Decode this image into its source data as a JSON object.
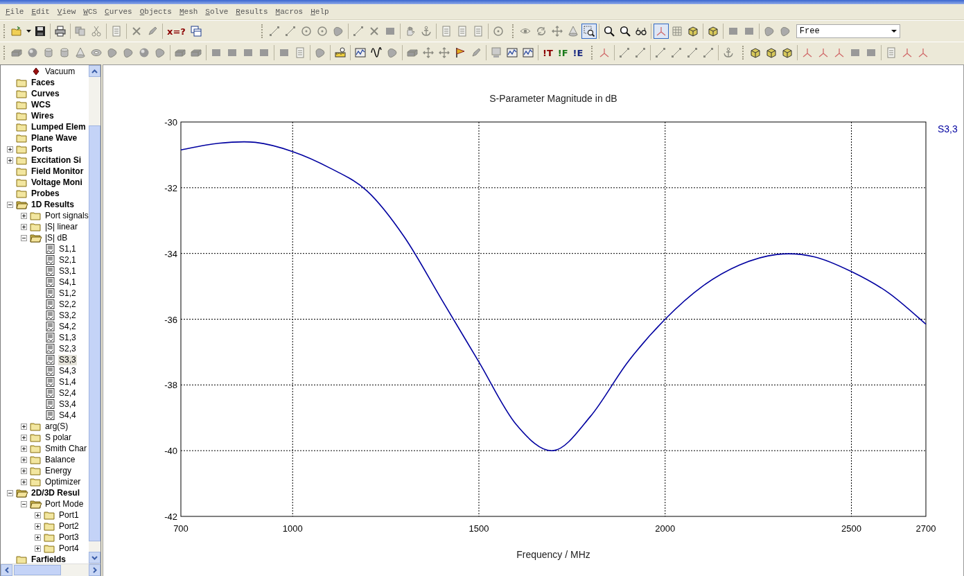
{
  "menu": [
    "File",
    "Edit",
    "View",
    "WCS",
    "Curves",
    "Objects",
    "Mesh",
    "Solve",
    "Results",
    "Macros",
    "Help"
  ],
  "toolbars": [
    {
      "bands": [
        {
          "groups": [
            [
              {
                "kind": "open",
                "pressed": false
              },
              {
                "kind": "caret",
                "pressed": false
              },
              {
                "kind": "save",
                "pressed": false
              }
            ],
            [
              {
                "kind": "print",
                "pressed": false
              }
            ],
            [
              {
                "kind": "copy",
                "pressed": false
              },
              {
                "kind": "cut",
                "pressed": false
              }
            ],
            [
              {
                "kind": "page",
                "pressed": false
              }
            ],
            [
              {
                "kind": "cross",
                "pressed": false
              },
              {
                "kind": "pick",
                "pressed": false
              }
            ],
            [
              {
                "kind": "text",
                "text": "x=?",
                "color": "#8b0000",
                "pressed": false
              },
              {
                "kind": "window",
                "pressed": false
              }
            ]
          ]
        },
        {
          "groups": [
            [
              {
                "kind": "line",
                "pressed": false
              },
              {
                "kind": "line",
                "pressed": false
              },
              {
                "kind": "circle",
                "pressed": false
              },
              {
                "kind": "circle",
                "pressed": false
              },
              {
                "kind": "shape",
                "pressed": false
              }
            ],
            [
              {
                "kind": "line",
                "pressed": false
              },
              {
                "kind": "cross",
                "pressed": false
              },
              {
                "kind": "square",
                "pressed": false
              }
            ],
            [
              {
                "kind": "hand",
                "pressed": false
              },
              {
                "kind": "anchor",
                "pressed": false
              }
            ],
            [
              {
                "kind": "page",
                "pressed": false
              },
              {
                "kind": "page",
                "pressed": false
              },
              {
                "kind": "page",
                "pressed": false
              }
            ],
            [
              {
                "kind": "circle",
                "pressed": false
              }
            ]
          ]
        },
        {
          "groups": [
            [
              {
                "kind": "eye",
                "pressed": false
              },
              {
                "kind": "rotate",
                "pressed": false
              },
              {
                "kind": "move",
                "pressed": false
              },
              {
                "kind": "cone",
                "pressed": false
              },
              {
                "kind": "zoom",
                "pressed": true
              }
            ],
            [
              {
                "kind": "search",
                "pressed": false
              },
              {
                "kind": "search",
                "pressed": false
              },
              {
                "kind": "glasses",
                "pressed": false
              }
            ],
            [
              {
                "kind": "axes",
                "pressed": true
              },
              {
                "kind": "grid",
                "pressed": false
              },
              {
                "kind": "cube",
                "pressed": false
              }
            ],
            [
              {
                "kind": "cube",
                "pressed": false
              }
            ],
            [
              {
                "kind": "square",
                "pressed": false
              },
              {
                "kind": "square",
                "pressed": false
              }
            ],
            [
              {
                "kind": "shape",
                "pressed": false
              },
              {
                "kind": "shape",
                "pressed": false
              }
            ]
          ],
          "combo": {
            "value": "Free"
          }
        }
      ]
    },
    {
      "bands": [
        {
          "groups": [
            [
              {
                "kind": "brick",
                "pressed": false
              },
              {
                "kind": "sphere",
                "pressed": false
              },
              {
                "kind": "cylinder",
                "pressed": false
              },
              {
                "kind": "cylinder",
                "pressed": false
              },
              {
                "kind": "cone",
                "pressed": false
              },
              {
                "kind": "ring",
                "pressed": false
              },
              {
                "kind": "shape",
                "pressed": false
              },
              {
                "kind": "shape",
                "pressed": false
              },
              {
                "kind": "sphere",
                "pressed": false
              },
              {
                "kind": "shape",
                "pressed": false
              }
            ],
            [
              {
                "kind": "brick",
                "pressed": false
              },
              {
                "kind": "brick",
                "pressed": false
              }
            ],
            [
              {
                "kind": "square",
                "pressed": false
              },
              {
                "kind": "square",
                "pressed": false
              },
              {
                "kind": "square",
                "pressed": false
              },
              {
                "kind": "square",
                "pressed": false
              }
            ],
            [
              {
                "kind": "square",
                "pressed": false
              },
              {
                "kind": "page",
                "pressed": false
              }
            ],
            [
              {
                "kind": "shape",
                "pressed": false
              }
            ],
            [
              {
                "kind": "ruler",
                "pressed": false
              }
            ],
            [
              {
                "kind": "chart",
                "pressed": false
              },
              {
                "kind": "sine",
                "pressed": false
              },
              {
                "kind": "shape",
                "pressed": false
              }
            ],
            [
              {
                "kind": "brick",
                "pressed": false
              },
              {
                "kind": "move",
                "pressed": false
              },
              {
                "kind": "move",
                "pressed": false
              },
              {
                "kind": "flag",
                "pressed": false
              },
              {
                "kind": "pick",
                "pressed": false
              }
            ],
            [
              {
                "kind": "monitor",
                "pressed": false
              },
              {
                "kind": "chart",
                "pressed": false
              },
              {
                "kind": "chart",
                "pressed": false
              }
            ],
            [
              {
                "kind": "text",
                "text": "!T",
                "color": "#8b0000",
                "pressed": false
              },
              {
                "kind": "text",
                "text": "!F",
                "color": "#1a7a1a",
                "pressed": false
              },
              {
                "kind": "text",
                "text": "!E",
                "color": "#1a2a80",
                "pressed": false
              }
            ]
          ]
        },
        {
          "groups": [
            [
              {
                "kind": "axes",
                "pressed": false
              }
            ],
            [
              {
                "kind": "line",
                "pressed": false
              },
              {
                "kind": "line",
                "pressed": false
              }
            ],
            [
              {
                "kind": "line",
                "pressed": false
              },
              {
                "kind": "line",
                "pressed": false
              },
              {
                "kind": "line",
                "pressed": false
              },
              {
                "kind": "line",
                "pressed": false
              }
            ],
            [
              {
                "kind": "anchor",
                "pressed": false
              }
            ]
          ]
        },
        {
          "groups": [
            [
              {
                "kind": "cube",
                "pressed": false
              },
              {
                "kind": "cube",
                "pressed": false
              },
              {
                "kind": "cube",
                "pressed": false
              }
            ],
            [
              {
                "kind": "axes",
                "pressed": false
              },
              {
                "kind": "axes",
                "pressed": false
              },
              {
                "kind": "axes",
                "pressed": false
              },
              {
                "kind": "square",
                "pressed": false
              },
              {
                "kind": "square",
                "pressed": false
              }
            ],
            [
              {
                "kind": "page",
                "pressed": false
              },
              {
                "kind": "axes",
                "pressed": false
              },
              {
                "kind": "axes",
                "pressed": false
              }
            ]
          ]
        }
      ]
    }
  ],
  "tree": {
    "items": [
      {
        "children": [
          {
            "label": "Vacuum",
            "kind": "material",
            "selected": false
          }
        ]
      },
      {
        "label": "Faces",
        "kind": "folder",
        "selected": false
      },
      {
        "label": "Curves",
        "kind": "folder",
        "selected": false
      },
      {
        "label": "WCS",
        "kind": "folder",
        "selected": false
      },
      {
        "label": "Wires",
        "kind": "folder",
        "selected": false
      },
      {
        "label": "Lumped Elem",
        "kind": "folder",
        "selected": false
      },
      {
        "label": "Plane Wave",
        "kind": "folder",
        "selected": false
      },
      {
        "label": "Ports",
        "kind": "folder",
        "selected": false,
        "expanded": false
      },
      {
        "label": "Excitation Si",
        "kind": "folder",
        "selected": false,
        "expanded": false
      },
      {
        "label": "Field Monitor",
        "kind": "folder",
        "selected": false
      },
      {
        "label": "Voltage Moni",
        "kind": "folder",
        "selected": false
      },
      {
        "label": "Probes",
        "kind": "folder",
        "selected": false
      },
      {
        "label": "1D Results",
        "kind": "folder",
        "selected": false,
        "expanded": true,
        "children": [
          {
            "label": "Port signals",
            "kind": "folder",
            "selected": false,
            "expanded": false
          },
          {
            "label": "|S| linear",
            "kind": "folder",
            "selected": false,
            "expanded": false
          },
          {
            "label": "|S| dB",
            "kind": "folder",
            "selected": false,
            "expanded": true,
            "children": [
              {
                "label": "S1,1",
                "kind": "curve",
                "selected": false
              },
              {
                "label": "S2,1",
                "kind": "curve",
                "selected": false
              },
              {
                "label": "S3,1",
                "kind": "curve",
                "selected": false
              },
              {
                "label": "S4,1",
                "kind": "curve",
                "selected": false
              },
              {
                "label": "S1,2",
                "kind": "curve",
                "selected": false
              },
              {
                "label": "S2,2",
                "kind": "curve",
                "selected": false
              },
              {
                "label": "S3,2",
                "kind": "curve",
                "selected": false
              },
              {
                "label": "S4,2",
                "kind": "curve",
                "selected": false
              },
              {
                "label": "S1,3",
                "kind": "curve",
                "selected": false
              },
              {
                "label": "S2,3",
                "kind": "curve",
                "selected": false
              },
              {
                "label": "S3,3",
                "kind": "curve",
                "selected": true
              },
              {
                "label": "S4,3",
                "kind": "curve",
                "selected": false
              },
              {
                "label": "S1,4",
                "kind": "curve",
                "selected": false
              },
              {
                "label": "S2,4",
                "kind": "curve",
                "selected": false
              },
              {
                "label": "S3,4",
                "kind": "curve",
                "selected": false
              },
              {
                "label": "S4,4",
                "kind": "curve",
                "selected": false
              }
            ]
          },
          {
            "label": "arg(S)",
            "kind": "folder",
            "selected": false,
            "expanded": false
          },
          {
            "label": "S polar",
            "kind": "folder",
            "selected": false,
            "expanded": false
          },
          {
            "label": "Smith Char",
            "kind": "folder",
            "selected": false,
            "expanded": false
          },
          {
            "label": "Balance",
            "kind": "folder",
            "selected": false,
            "expanded": false
          },
          {
            "label": "Energy",
            "kind": "folder",
            "selected": false,
            "expanded": false
          },
          {
            "label": "Optimizer",
            "kind": "folder",
            "selected": false,
            "expanded": false
          }
        ]
      },
      {
        "label": "2D/3D Resul",
        "kind": "folder",
        "selected": false,
        "expanded": true,
        "children": [
          {
            "label": "Port Mode",
            "kind": "folder",
            "selected": false,
            "expanded": true,
            "children": [
              {
                "label": "Port1",
                "kind": "folder",
                "selected": false,
                "expanded": false
              },
              {
                "label": "Port2",
                "kind": "folder",
                "selected": false,
                "expanded": false
              },
              {
                "label": "Port3",
                "kind": "folder",
                "selected": false,
                "expanded": false
              },
              {
                "label": "Port4",
                "kind": "folder",
                "selected": false,
                "expanded": false
              }
            ]
          }
        ]
      },
      {
        "label": "Farfields",
        "kind": "folder",
        "selected": false
      }
    ]
  },
  "plot": {
    "chart_data": {
      "type": "line",
      "title": "S-Parameter Magnitude in dB",
      "xlabel": "Frequency / MHz",
      "x": [
        700,
        800,
        900,
        1000,
        1100,
        1200,
        1300,
        1400,
        1500,
        1600,
        1700,
        1800,
        1900,
        2000,
        2100,
        2200,
        2300,
        2400,
        2500,
        2600,
        2700
      ],
      "series": [
        {
          "name": "S3,3",
          "color": "#0000a0",
          "values": [
            -30.85,
            -30.65,
            -30.62,
            -30.9,
            -31.4,
            -32.1,
            -33.5,
            -35.4,
            -37.3,
            -39.2,
            -40.0,
            -38.95,
            -37.3,
            -36.0,
            -35.0,
            -34.35,
            -34.03,
            -34.1,
            -34.55,
            -35.2,
            -36.15
          ]
        }
      ],
      "xlim": [
        700,
        2700
      ],
      "ylim": [
        -42,
        -30
      ],
      "xticks": [
        700,
        1000,
        1500,
        2000,
        2500,
        2700
      ],
      "yticks": [
        -30,
        -32,
        -34,
        -36,
        -38,
        -40,
        -42
      ],
      "grid": true
    }
  }
}
